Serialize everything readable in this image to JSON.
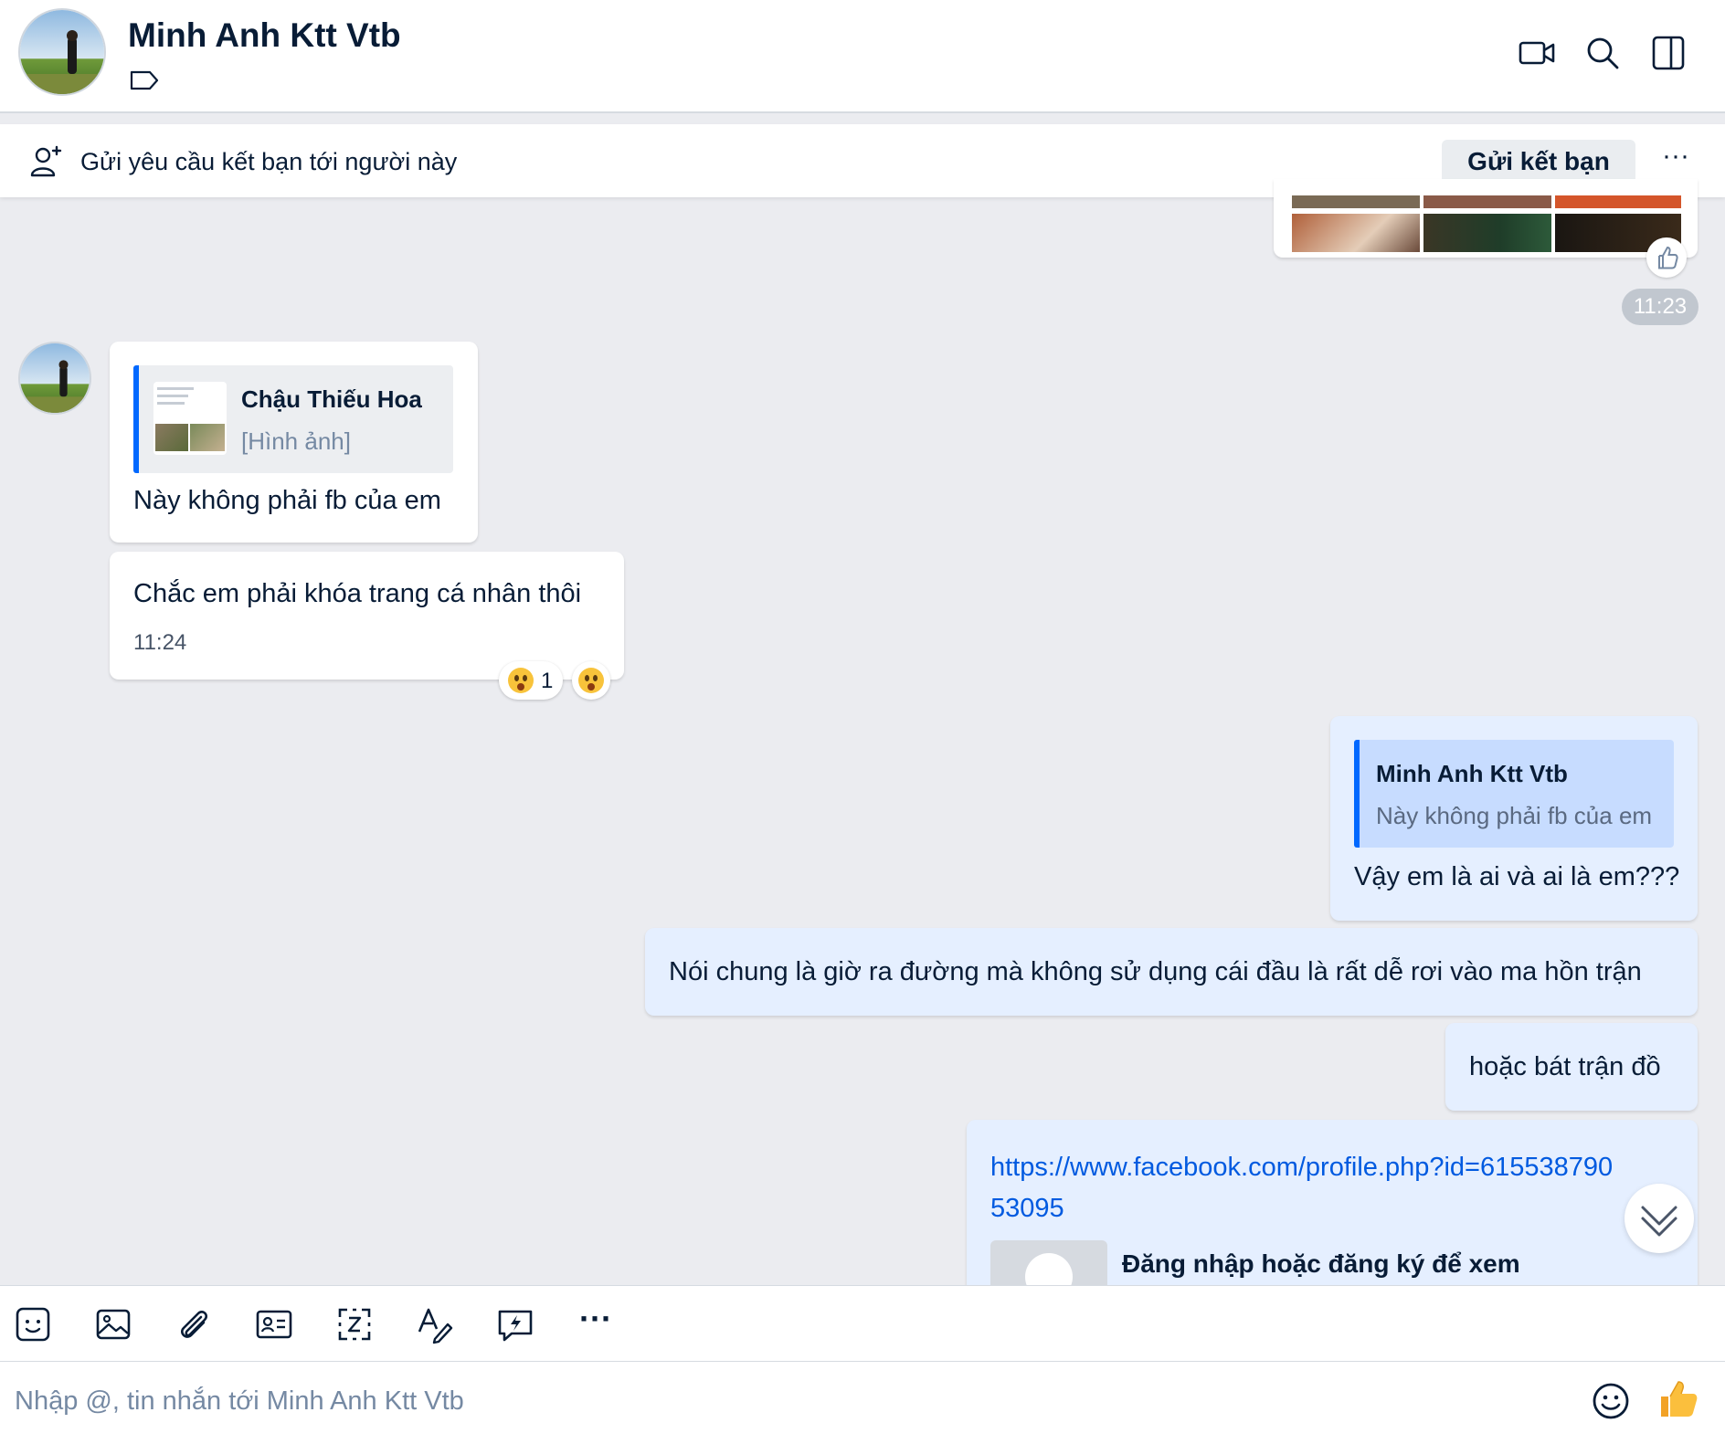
{
  "header": {
    "title": "Minh Anh Ktt Vtb"
  },
  "friend_request": {
    "text": "Gửi yêu cầu kết bạn tới người này",
    "button_label": "Gửi kết bạn",
    "more_label": "···"
  },
  "messages": {
    "photo_time": "11:23",
    "incoming_1": {
      "quote_author": "Chậu Thiếu Hoa",
      "quote_preview": "[Hình ảnh]",
      "text": "Này không phải fb của em"
    },
    "incoming_2": {
      "text": "Chắc em phải khóa trang cá nhân thôi",
      "time": "11:24",
      "reaction_count": "1"
    },
    "outgoing_1": {
      "quote_author": "Minh Anh Ktt Vtb",
      "quote_preview": "Này không phải fb của em",
      "text": "Vậy em là ai và ai là em???"
    },
    "outgoing_2": {
      "text": "Nói chung là giờ ra đường mà không sử dụng cái đầu là rất dễ rơi vào ma hồn trận"
    },
    "outgoing_3": {
      "text": "hoặc bát trận đồ"
    },
    "outgoing_link": {
      "url_line1": "https://www.facebook.com/profile.php?id=615538790",
      "url_line2": "53095",
      "preview_title": "Đăng nhập hoặc đăng ký để xem"
    }
  },
  "composer": {
    "placeholder": "Nhập @, tin nhắn tới Minh Anh Ktt Vtb",
    "toolbar_more": "···"
  },
  "colors": {
    "accent": "#0068ff",
    "link": "#005ae0",
    "background": "#ebecf0",
    "outgoing_bubble": "#e5efff"
  }
}
